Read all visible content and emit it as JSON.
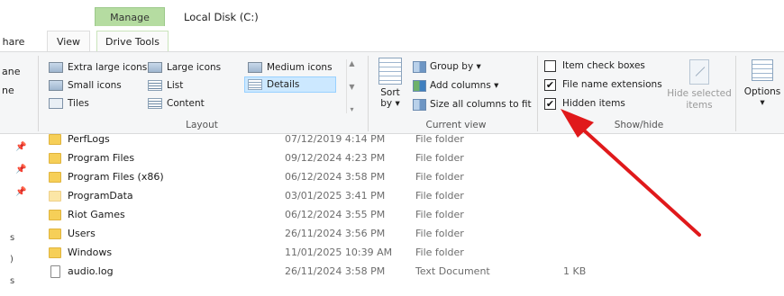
{
  "title_bar": {
    "manage_label": "Manage",
    "window_title": "Local Disk (C:)"
  },
  "tabs": {
    "share": "hare",
    "view": "View",
    "drive_tools": "Drive Tools"
  },
  "ribbon": {
    "left_cut": [
      "ane",
      "ne"
    ],
    "layout": {
      "group_label": "Layout",
      "items": {
        "extra_large": "Extra large icons",
        "large": "Large icons",
        "medium": "Medium icons",
        "small": "Small icons",
        "list": "List",
        "details": "Details",
        "tiles": "Tiles",
        "content": "Content"
      },
      "selected": "Details"
    },
    "current_view": {
      "group_label": "Current view",
      "sort_label": "Sort",
      "sort_by": "by",
      "group_by": "Group by",
      "add_columns": "Add columns",
      "size_all_columns": "Size all columns to fit"
    },
    "show_hide": {
      "group_label": "Show/hide",
      "item_check_boxes": {
        "label": "Item check boxes",
        "checked": false
      },
      "file_name_extensions": {
        "label": "File name extensions",
        "checked": true
      },
      "hidden_items": {
        "label": "Hidden items",
        "checked": true
      },
      "hide_selected_items": "Hide selected items"
    },
    "options_label": "Options"
  },
  "nav_pane": {
    "fragments": [
      "s",
      ")",
      "s"
    ]
  },
  "files": [
    {
      "name": "PerfLogs",
      "date": "07/12/2019 4:14 PM",
      "type": "File folder",
      "size": "",
      "icon": "folder-icon"
    },
    {
      "name": "Program Files",
      "date": "09/12/2024 4:23 PM",
      "type": "File folder",
      "size": "",
      "icon": "folder-icon"
    },
    {
      "name": "Program Files (x86)",
      "date": "06/12/2024 3:58 PM",
      "type": "File folder",
      "size": "",
      "icon": "folder-icon"
    },
    {
      "name": "ProgramData",
      "date": "03/01/2025 3:41 PM",
      "type": "File folder",
      "size": "",
      "icon": "hidden-folder-icon"
    },
    {
      "name": "Riot Games",
      "date": "06/12/2024 3:55 PM",
      "type": "File folder",
      "size": "",
      "icon": "folder-icon"
    },
    {
      "name": "Users",
      "date": "26/11/2024 3:56 PM",
      "type": "File folder",
      "size": "",
      "icon": "folder-icon"
    },
    {
      "name": "Windows",
      "date": "11/01/2025 10:39 AM",
      "type": "File folder",
      "size": "",
      "icon": "folder-icon"
    },
    {
      "name": "audio.log",
      "date": "26/11/2024 3:58 PM",
      "type": "Text Document",
      "size": "1 KB",
      "icon": "text-file-icon"
    }
  ],
  "colors": {
    "manage_tab": "#b5dca1",
    "ribbon_bg": "#f5f6f7",
    "selection": "#cce8ff",
    "folder": "#f6cf58",
    "annotation_arrow": "#e0191b"
  }
}
